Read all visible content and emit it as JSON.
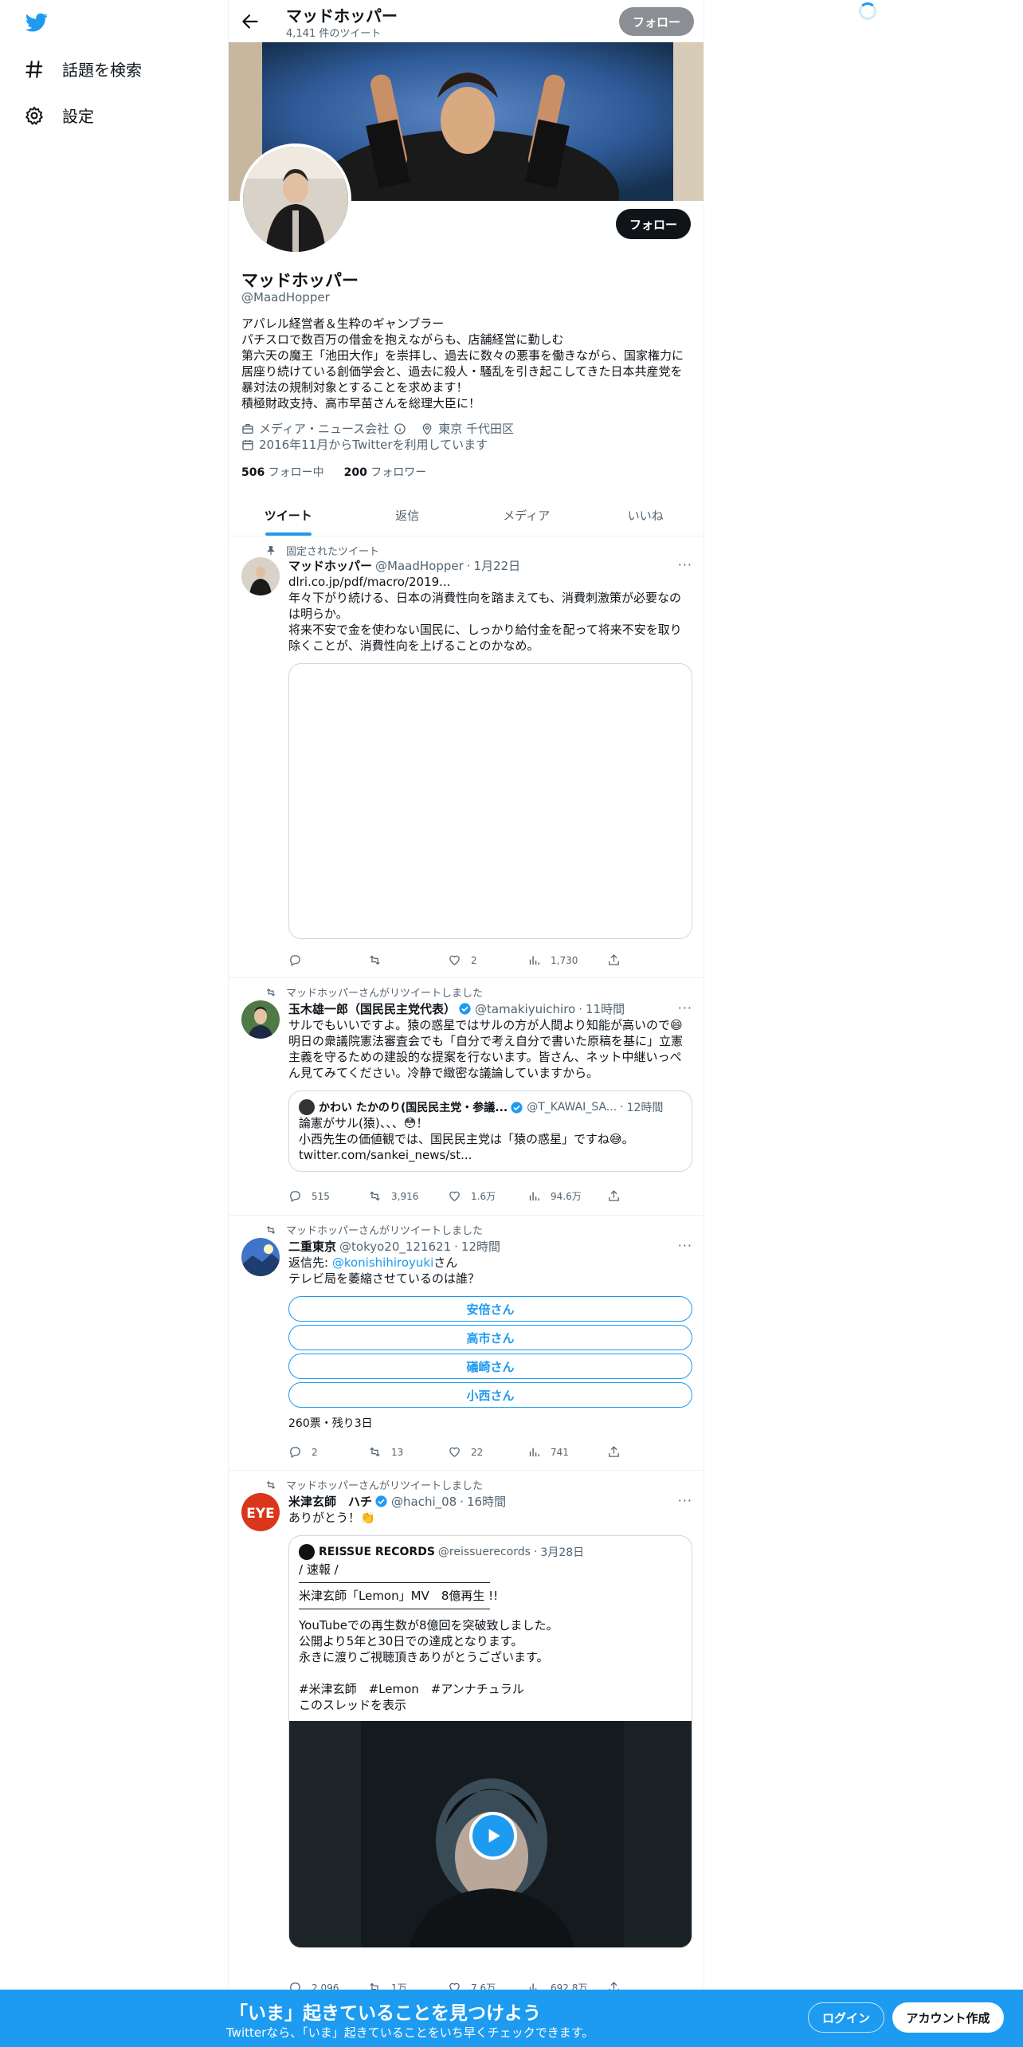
{
  "nav": {
    "explore_label": "話題を検索",
    "settings_label": "設定"
  },
  "topbar": {
    "name": "マッドホッパー",
    "tweet_count": "4,141 件のツイート",
    "follow_label": "フォロー"
  },
  "profile": {
    "follow_label": "フォロー",
    "name": "マッドホッパー",
    "handle": "@MaadHopper",
    "bio": [
      "アパレル経営者＆生粋のギャンブラー",
      "パチスロで数百万の借金を抱えながらも、店舗経営に勤しむ",
      "第六天の魔王「池田大作」を崇拝し、過去に数々の悪事を働きながら、国家権力に",
      "居座り続けている創価学会と、過去に殺人・騒乱を引き起こしてきた日本共産党を",
      "暴対法の規制対象とすることを求めます！",
      "積極財政支持、高市早苗さんを総理大臣に！"
    ],
    "category": "メディア・ニュース会社",
    "location": "東京 千代田区",
    "joined": "2016年11月からTwitterを利用しています",
    "following_count": "506",
    "following_label": "フォロー中",
    "followers_count": "200",
    "followers_label": "フォロワー"
  },
  "tabs": [
    "ツイート",
    "返信",
    "メディア",
    "いいね"
  ],
  "tweets": {
    "t1": {
      "context": "固定されたツイート",
      "name": "マッドホッパー",
      "handle": "@MaadHopper",
      "time": "1月22日",
      "link": "dlri.co.jp/pdf/macro/2019...",
      "lines": [
        "年々下がり続ける、日本の消費性向を踏まえても、消費刺激策が必要なの",
        "は明らか。",
        "将来不安で金を使わない国民に、しっかり給付金を配って将来不安を取り",
        "除くことが、消費性向を上げることのかなめ。"
      ],
      "replies": "",
      "retweets": "",
      "likes": "2",
      "views": "1,730"
    },
    "t2": {
      "context": "マッドホッパーさんがリツイートしました",
      "name": "玉木雄一郎（国民民主党代表）",
      "handle": "@tamakiyuichiro",
      "time": "11時間",
      "lines": [
        "サルでもいいですよ。猿の惑星ではサルの方が人間より知能が高いので😄",
        "明日の衆議院憲法審査会でも「自分で考え自分で書いた原稿を基に」立憲",
        "主義を守るための建設的な提案を行ないます。皆さん、ネット中継いっぺ",
        "ん見てみてください。冷静で緻密な議論していますから。"
      ],
      "quote_name": "かわい たかのり(国民民主党・参議...",
      "quote_handle": "@T_KAWAI_SA...",
      "quote_time": "12時間",
      "quote_lines": [
        "論憲がサル(猿)、、、😳！",
        "小西先生の価値観では、国民民主党は「猿の惑星」ですね😅。"
      ],
      "quote_link": "twitter.com/sankei_news/st...",
      "replies": "515",
      "retweets": "3,916",
      "likes": "1.6万",
      "views": "94.6万"
    },
    "t3": {
      "context": "マッドホッパーさんがリツイートしました",
      "name": "二重東京",
      "handle": "@tokyo20_121621",
      "time": "12時間",
      "reply_label": "返信先: ",
      "reply_to": "@konishihiroyuki",
      "reply_suffix": "さん",
      "text": "テレビ局を萎縮させているのは誰？",
      "poll": [
        "安倍さん",
        "高市さん",
        "礒崎さん",
        "小西さん"
      ],
      "poll_meta": "260票・残り3日",
      "replies": "2",
      "retweets": "13",
      "likes": "22",
      "views": "741"
    },
    "t4": {
      "context": "マッドホッパーさんがリツイートしました",
      "name": "米津玄師　ハチ",
      "handle": "@hachi_08",
      "time": "16時間",
      "text": "ありがとう！👏",
      "quote_name": "REISSUE RECORDS",
      "quote_handle": "@reissuerecords",
      "quote_time": "3月28日",
      "quote_lines": [
        "/ 速報 /",
        "米津玄師「Lemon」MV　8億再生 !!",
        "YouTubeでの再生数が8億回を突破致しました。",
        "公開より5年と30日での達成となります。",
        "永きに渡りご視聴頂きありがとうございます。",
        "#米津玄師　#Lemon　#アンナチュラル"
      ],
      "thread_link": "このスレッドを表示",
      "replies": "2,096",
      "retweets": "1万",
      "likes": "7.6万",
      "views": "692.8万"
    }
  },
  "bottom_bar": {
    "title": "「いま」起きていることを見つけよう",
    "subtitle": "Twitterなら、「いま」起きていることをいち早くチェックできます。",
    "login_label": "ログイン",
    "signup_label": "アカウント作成"
  },
  "colors": {
    "accent": "#1d9bf0",
    "text": "#0f1419",
    "muted": "#536471"
  }
}
